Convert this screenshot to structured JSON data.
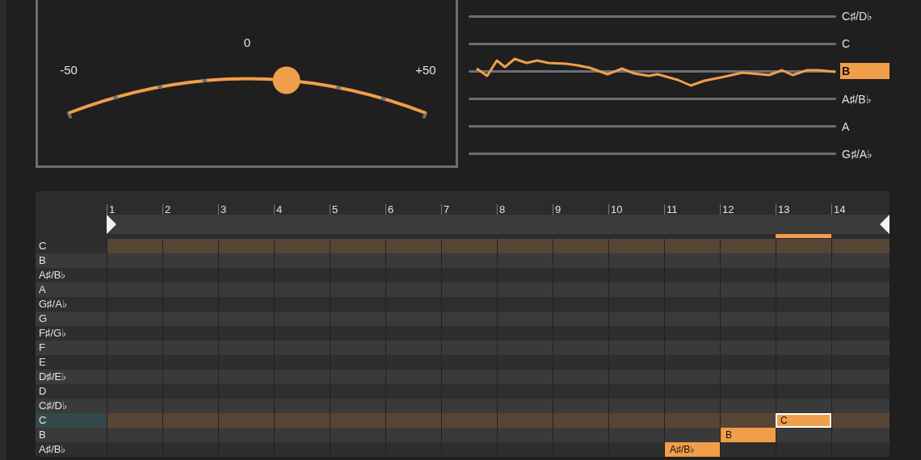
{
  "tuner": {
    "scale_labels": [
      "-50",
      "0",
      "+50"
    ],
    "level": 0.61
  },
  "pitch_view": {
    "notes": [
      {
        "label": "C♯/D♭",
        "selected": false
      },
      {
        "label": "C",
        "selected": false
      },
      {
        "label": "B",
        "selected": true
      },
      {
        "label": "A♯/B♭",
        "selected": false
      },
      {
        "label": "A",
        "selected": false
      },
      {
        "label": "G♯/A♭",
        "selected": false
      }
    ]
  },
  "piano_roll": {
    "columns": [
      {
        "number": "1",
        "marker": false
      },
      {
        "number": "2",
        "marker": false
      },
      {
        "number": "3",
        "marker": false
      },
      {
        "number": "4",
        "marker": false
      },
      {
        "number": "5",
        "marker": false
      },
      {
        "number": "6",
        "marker": false
      },
      {
        "number": "7",
        "marker": false
      },
      {
        "number": "8",
        "marker": false
      },
      {
        "number": "9",
        "marker": false
      },
      {
        "number": "10",
        "marker": false
      },
      {
        "number": "11",
        "marker": false
      },
      {
        "number": "12",
        "marker": false
      },
      {
        "number": "13",
        "marker": true
      },
      {
        "number": "14",
        "marker": false
      }
    ],
    "rows": [
      {
        "label": "C",
        "root": true,
        "selected": false,
        "cells": [
          null,
          null,
          null,
          null,
          null,
          null,
          null,
          null,
          null,
          null,
          null,
          null,
          null,
          null
        ]
      },
      {
        "label": "B",
        "root": false,
        "selected": false,
        "cells": [
          null,
          null,
          null,
          null,
          null,
          null,
          null,
          null,
          null,
          null,
          null,
          null,
          null,
          null
        ]
      },
      {
        "label": "A♯/B♭",
        "root": false,
        "selected": false,
        "cells": [
          null,
          null,
          null,
          null,
          null,
          null,
          null,
          null,
          null,
          null,
          null,
          null,
          null,
          null
        ]
      },
      {
        "label": "A",
        "root": false,
        "selected": false,
        "cells": [
          null,
          null,
          null,
          null,
          null,
          null,
          null,
          null,
          null,
          null,
          null,
          null,
          null,
          null
        ]
      },
      {
        "label": "G♯/A♭",
        "root": false,
        "selected": false,
        "cells": [
          null,
          null,
          null,
          null,
          null,
          null,
          null,
          null,
          null,
          null,
          null,
          null,
          null,
          null
        ]
      },
      {
        "label": "G",
        "root": false,
        "selected": false,
        "cells": [
          null,
          null,
          null,
          null,
          null,
          null,
          null,
          null,
          null,
          null,
          null,
          null,
          null,
          null
        ]
      },
      {
        "label": "F♯/G♭",
        "root": false,
        "selected": false,
        "cells": [
          null,
          null,
          null,
          null,
          null,
          null,
          null,
          null,
          null,
          null,
          null,
          null,
          null,
          null
        ]
      },
      {
        "label": "F",
        "root": false,
        "selected": false,
        "cells": [
          null,
          null,
          null,
          null,
          null,
          null,
          null,
          null,
          null,
          null,
          null,
          null,
          null,
          null
        ]
      },
      {
        "label": "E",
        "root": false,
        "selected": false,
        "cells": [
          null,
          null,
          null,
          null,
          null,
          null,
          null,
          null,
          null,
          null,
          null,
          null,
          null,
          null
        ]
      },
      {
        "label": "D♯/E♭",
        "root": false,
        "selected": false,
        "cells": [
          null,
          null,
          null,
          null,
          null,
          null,
          null,
          null,
          null,
          null,
          null,
          null,
          null,
          null
        ]
      },
      {
        "label": "D",
        "root": false,
        "selected": false,
        "cells": [
          null,
          null,
          null,
          null,
          null,
          null,
          null,
          null,
          null,
          null,
          null,
          null,
          null,
          null
        ]
      },
      {
        "label": "C♯/D♭",
        "root": false,
        "selected": false,
        "cells": [
          null,
          null,
          null,
          null,
          null,
          null,
          null,
          null,
          null,
          null,
          null,
          null,
          null,
          null
        ]
      },
      {
        "label": "C",
        "root": true,
        "selected": true,
        "cells": [
          null,
          null,
          null,
          null,
          null,
          null,
          null,
          null,
          null,
          null,
          null,
          null,
          {
            "note": "C",
            "selected": true
          },
          null
        ]
      },
      {
        "label": "B",
        "root": false,
        "selected": false,
        "cells": [
          null,
          null,
          null,
          null,
          null,
          null,
          null,
          null,
          null,
          null,
          null,
          {
            "note": "B",
            "selected": false
          },
          null,
          null
        ]
      },
      {
        "label": "A♯/B♭",
        "root": false,
        "selected": false,
        "cells": [
          null,
          null,
          null,
          null,
          null,
          null,
          null,
          null,
          null,
          null,
          {
            "note": "A♯/B♭",
            "selected": false
          },
          null,
          null,
          null
        ]
      }
    ]
  }
}
